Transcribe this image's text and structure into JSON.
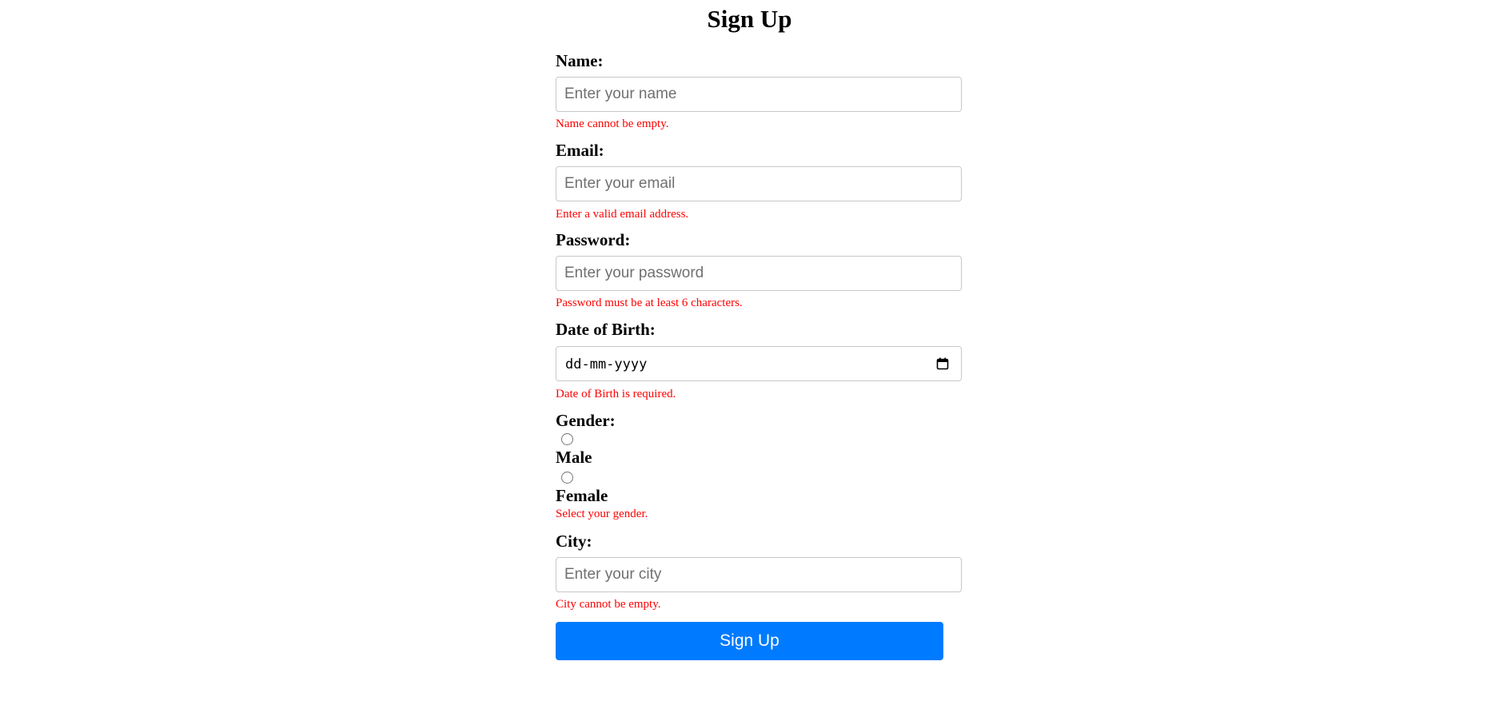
{
  "page": {
    "title": "Sign Up"
  },
  "form": {
    "name": {
      "label": "Name:",
      "placeholder": "Enter your name",
      "value": "",
      "error": "Name cannot be empty."
    },
    "email": {
      "label": "Email:",
      "placeholder": "Enter your email",
      "value": "",
      "error": "Enter a valid email address."
    },
    "password": {
      "label": "Password:",
      "placeholder": "Enter your password",
      "value": "",
      "error": "Password must be at least 6 characters."
    },
    "dob": {
      "label": "Date of Birth:",
      "display": "dd-mm-yyyy",
      "icon": "calendar-icon",
      "error": "Date of Birth is required."
    },
    "gender": {
      "label": "Gender:",
      "options": [
        {
          "label": "Male",
          "checked": false
        },
        {
          "label": "Female",
          "checked": false
        }
      ],
      "error": "Select your gender."
    },
    "city": {
      "label": "City:",
      "placeholder": "Enter your city",
      "value": "",
      "error": "City cannot be empty."
    },
    "submit": {
      "label": "Sign Up"
    }
  },
  "colors": {
    "accent": "#007bff",
    "error": "#ff0000",
    "border": "#c8c8c8"
  }
}
